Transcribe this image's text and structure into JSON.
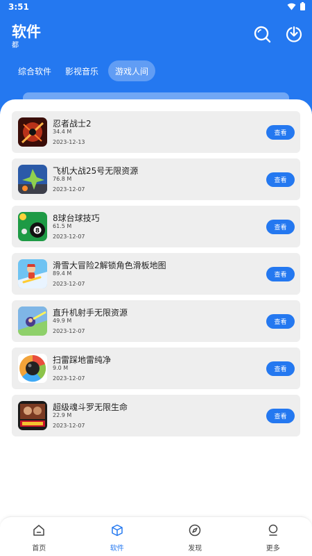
{
  "status": {
    "time": "3:51"
  },
  "header": {
    "title": "软件",
    "subtitle": "都"
  },
  "tabs": [
    {
      "label": "综合软件",
      "active": false
    },
    {
      "label": "影视音乐",
      "active": false
    },
    {
      "label": "游戏人间",
      "active": true
    }
  ],
  "apps": [
    {
      "name": "忍者战士2",
      "size": "34.4 M",
      "date": "2023-12-13",
      "button": "查看",
      "icon": "ninja-warrior-icon"
    },
    {
      "name": "飞机大战25号无限资源",
      "size": "76.8 M",
      "date": "2023-12-07",
      "button": "查看",
      "icon": "plane-war-icon"
    },
    {
      "name": "8球台球技巧",
      "size": "61.5 M",
      "date": "2023-12-07",
      "button": "查看",
      "icon": "billiards-icon"
    },
    {
      "name": "滑雪大冒险2解锁角色滑板地图",
      "size": "89.4 M",
      "date": "2023-12-07",
      "button": "查看",
      "icon": "ski-adventure-icon"
    },
    {
      "name": "直升机射手无限资源",
      "size": "49.9 M",
      "date": "2023-12-07",
      "button": "查看",
      "icon": "helicopter-shooter-icon"
    },
    {
      "name": "扫雷踩地雷纯净",
      "size": "9.0 M",
      "date": "2023-12-07",
      "button": "查看",
      "icon": "minesweeper-icon"
    },
    {
      "name": "超级魂斗罗无限生命",
      "size": "22.9 M",
      "date": "2023-12-07",
      "button": "查看",
      "icon": "contra-icon"
    }
  ],
  "nav": [
    {
      "label": "首页",
      "icon": "home-icon",
      "active": false
    },
    {
      "label": "软件",
      "icon": "cube-icon",
      "active": true
    },
    {
      "label": "发现",
      "icon": "compass-icon",
      "active": false
    },
    {
      "label": "更多",
      "icon": "user-icon",
      "active": false
    }
  ],
  "colors": {
    "primary": "#2478f0",
    "card": "#eeeeee",
    "text": "#222222"
  }
}
